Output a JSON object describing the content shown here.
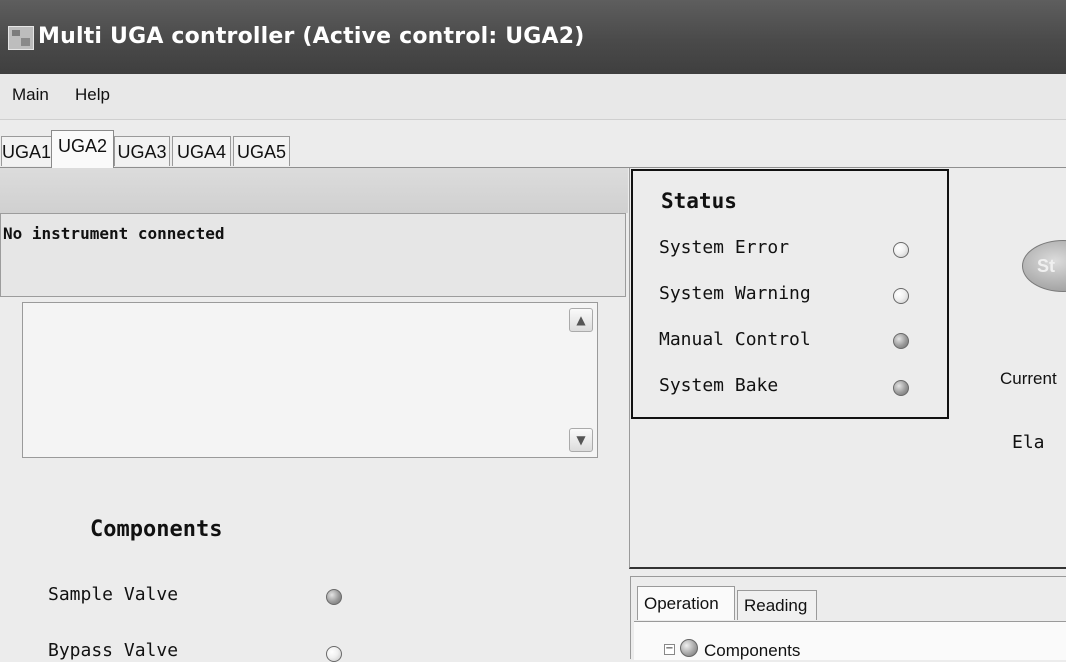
{
  "window": {
    "title": "Multi UGA controller  (Active control: UGA2)",
    "icon": "app-grid-icon"
  },
  "menu": {
    "items": [
      "Main",
      "Help"
    ]
  },
  "tabs": [
    {
      "label": "UGA1",
      "active": false
    },
    {
      "label": "UGA2",
      "active": true
    },
    {
      "label": "UGA3",
      "active": false
    },
    {
      "label": "UGA4",
      "active": false
    },
    {
      "label": "UGA5",
      "active": false
    }
  ],
  "connection": {
    "message": "No instrument connected"
  },
  "log": {
    "text": "",
    "scroll_up_icon": "scroll-up-arrow-icon",
    "scroll_down_icon": "scroll-down-arrow-icon"
  },
  "components": {
    "title": "Components",
    "items": [
      {
        "label": "Sample Valve",
        "state": "gray"
      },
      {
        "label": "Bypass Valve",
        "state": "off"
      }
    ]
  },
  "status": {
    "title": "Status",
    "items": [
      {
        "label": "System Error",
        "state": "off"
      },
      {
        "label": "System Warning",
        "state": "off"
      },
      {
        "label": "Manual Control",
        "state": "gray"
      },
      {
        "label": "System Bake",
        "state": "gray"
      }
    ]
  },
  "controls": {
    "start_button": "St",
    "current_label": "Current",
    "elapsed_label": "Ela"
  },
  "operation": {
    "tabs": [
      {
        "label": "Operation",
        "active": true
      },
      {
        "label": "Reading",
        "active": false
      }
    ],
    "tree": {
      "expander": "−",
      "root_label": "Components"
    }
  },
  "colors": {
    "title_bar": "#4a4a4a",
    "window_bg": "#ececec",
    "led_off": "#f0f0f0",
    "led_gray": "#9a9a9a"
  }
}
